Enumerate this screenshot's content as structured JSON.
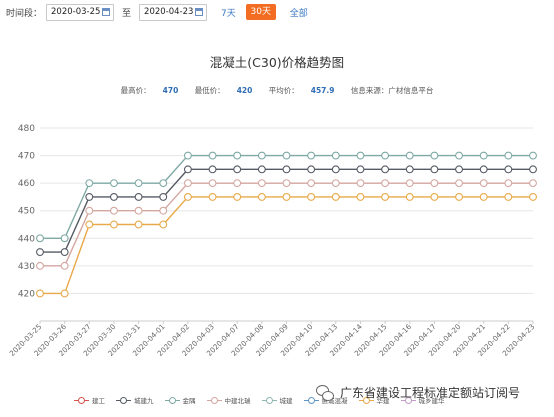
{
  "toolbar": {
    "time_label": "时间段：",
    "start_date": "2020-03-25",
    "to_label": "至",
    "end_date": "2020-04-23",
    "period_7": "7天",
    "period_30": "30天",
    "period_all": "全部"
  },
  "stats": {
    "max_label": "最高价：",
    "max_value": "470",
    "min_label": "最低价：",
    "min_value": "420",
    "avg_label": "平均价：",
    "avg_value": "457.9",
    "source_label": "信息来源：广材信息平台"
  },
  "watermark": {
    "text": "广东省建设工程标准定额站订阅号"
  },
  "chart_data": {
    "type": "line",
    "title": "混凝土(C30)价格趋势图",
    "xlabel": "",
    "ylabel": "",
    "ylim": [
      410,
      480
    ],
    "yticks": [
      420,
      430,
      440,
      450,
      460,
      470,
      480
    ],
    "grid": true,
    "legend_position": "bottom",
    "categories": [
      "2020-03-25",
      "2020-03-26",
      "2020-03-27",
      "2020-03-30",
      "2020-03-31",
      "2020-04-01",
      "2020-04-02",
      "2020-04-03",
      "2020-04-07",
      "2020-04-08",
      "2020-04-09",
      "2020-04-10",
      "2020-04-13",
      "2020-04-14",
      "2020-04-15",
      "2020-04-16",
      "2020-04-17",
      "2020-04-20",
      "2020-04-21",
      "2020-04-22",
      "2020-04-23"
    ],
    "series": [
      {
        "name": "金隅",
        "color": "#7ea9a4",
        "values": [
          440,
          440,
          460,
          460,
          460,
          460,
          470,
          470,
          470,
          470,
          470,
          470,
          470,
          470,
          470,
          470,
          470,
          470,
          470,
          470,
          470
        ]
      },
      {
        "name": "城建九",
        "color": "#555a64",
        "values": [
          435,
          435,
          455,
          455,
          455,
          455,
          465,
          465,
          465,
          465,
          465,
          465,
          465,
          465,
          465,
          465,
          465,
          465,
          465,
          465,
          465
        ]
      },
      {
        "name": "中建北瑞",
        "color": "#d4a6a0",
        "values": [
          430,
          430,
          450,
          450,
          450,
          450,
          460,
          460,
          460,
          460,
          460,
          460,
          460,
          460,
          460,
          460,
          460,
          460,
          460,
          460,
          460
        ]
      },
      {
        "name": "华建",
        "color": "#e8a94a",
        "values": [
          420,
          420,
          445,
          445,
          445,
          445,
          455,
          455,
          455,
          455,
          455,
          455,
          455,
          455,
          455,
          455,
          455,
          455,
          455,
          455,
          455
        ]
      }
    ],
    "legend": [
      {
        "name": "建工",
        "color": "#d9534f"
      },
      {
        "name": "城建九",
        "color": "#555a64"
      },
      {
        "name": "金隅",
        "color": "#7ea9a4"
      },
      {
        "name": "中建北瑞",
        "color": "#d4a6a0"
      },
      {
        "name": "城建",
        "color": "#8fb8b0"
      },
      {
        "name": "惠城混凝",
        "color": "#5f96c6"
      },
      {
        "name": "华建",
        "color": "#e8a94a"
      },
      {
        "name": "城乡建华",
        "color": "#c29bc8"
      }
    ]
  }
}
